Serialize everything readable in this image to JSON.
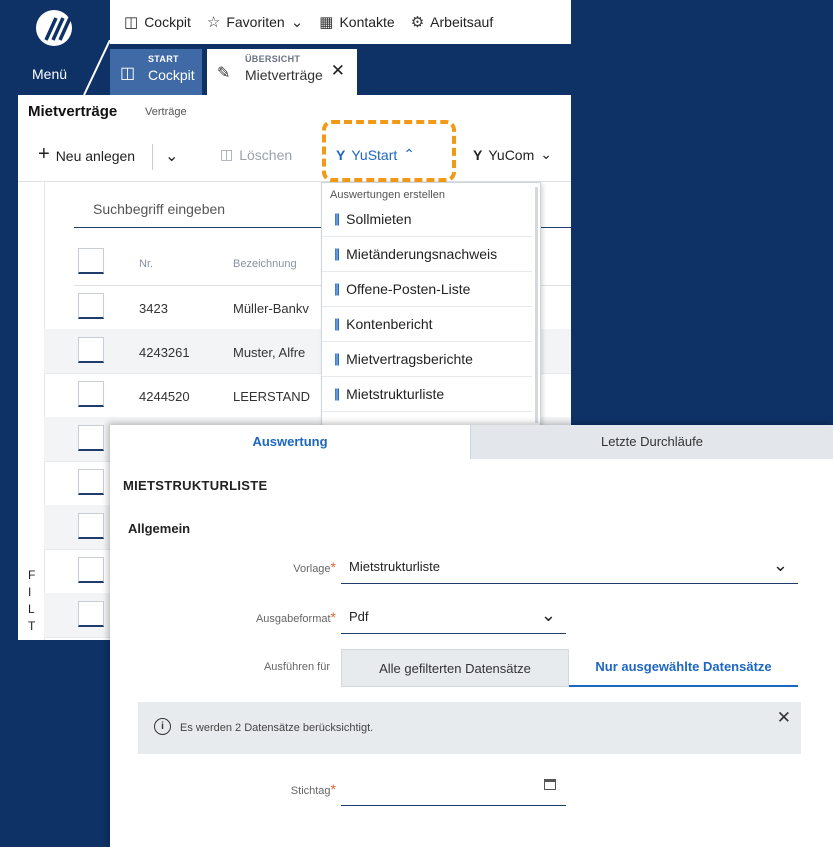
{
  "brand": {
    "menu_label": "Menü"
  },
  "topnav": [
    {
      "label": "Cockpit",
      "icon": "cockpit-icon"
    },
    {
      "label": "Favoriten",
      "icon": "star-icon"
    },
    {
      "label": "Kontakte",
      "icon": "contacts-icon"
    },
    {
      "label": "Arbeitsauf",
      "icon": "tasks-icon"
    }
  ],
  "tabs": {
    "start": {
      "small": "START",
      "label": "Cockpit"
    },
    "overview": {
      "small": "ÜBERSICHT",
      "label": "Mietverträge"
    }
  },
  "page": {
    "title": "Mietverträge",
    "subtitle": "Verträge"
  },
  "toolbar": {
    "new_label": "Neu anlegen",
    "delete_label": "Löschen",
    "yustart_label": "YuStart",
    "yucom_label": "YuCom"
  },
  "filter_vertical": [
    "F",
    "I",
    "L",
    "T"
  ],
  "search": {
    "placeholder": "Suchbegriff eingeben"
  },
  "table": {
    "columns": {
      "nr": "Nr.",
      "bezeichnung": "Bezeichnung"
    },
    "rows": [
      {
        "nr": "3423",
        "bezeichnung": "Müller-Bankv"
      },
      {
        "nr": "4243261",
        "bezeichnung": "Muster, Alfre"
      },
      {
        "nr": "4244520",
        "bezeichnung": "LEERSTAND"
      }
    ]
  },
  "dropdown": {
    "header": "Auswertungen erstellen",
    "items": [
      "Sollmieten",
      "Mietänderungsnachweis",
      "Offene-Posten-Liste",
      "Kontenbericht",
      "Mietvertragsberichte",
      "Mietstrukturliste"
    ]
  },
  "dialog": {
    "tab_active": "Auswertung",
    "tab_inactive": "Letzte Durchläufe",
    "title": "MIETSTRUKTURLISTE",
    "section": "Allgemein",
    "vorlage_label": "Vorlage",
    "vorlage_value": "Mietstrukturliste",
    "format_label": "Ausgabeformat",
    "format_value": "Pdf",
    "run_for_label": "Ausführen für",
    "run_for_options": [
      "Alle gefilterten Datensätze",
      "Nur ausgewählte Datensätze"
    ],
    "run_for_selected": "Nur ausgewählte Datensätze",
    "info_text": "Es werden 2 Datensätze berücksichtigt.",
    "stichtag_label": "Stichtag",
    "stichtag_value": ""
  },
  "colors": {
    "navy": "#0e3266",
    "accent_blue": "#1d67c2",
    "highlight_orange": "#f29a17",
    "required_orange": "#e0662d"
  }
}
